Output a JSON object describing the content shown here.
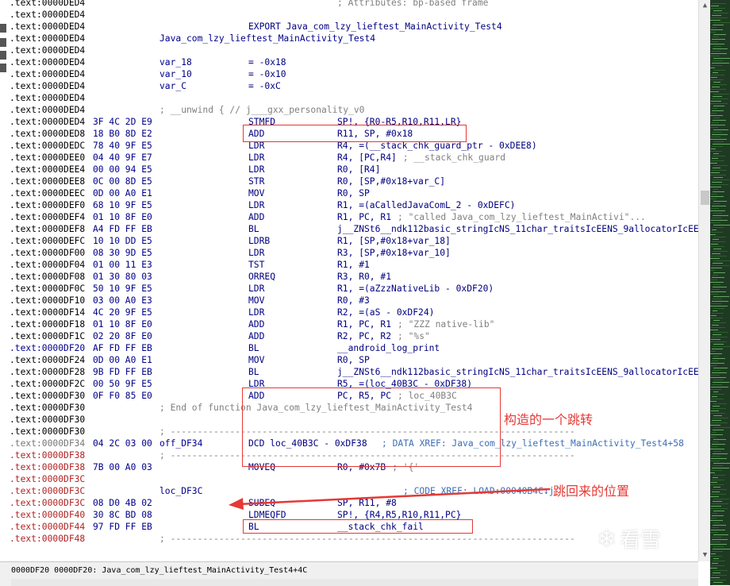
{
  "listing": [
    {
      "addr": ".text:0000DED4",
      "seg": "black",
      "bytes": "",
      "label": "",
      "mnem": "",
      "ops": "",
      "comment": "; Attributes: bp-based frame",
      "cc": "gray"
    },
    {
      "addr": ".text:0000DED4",
      "seg": "black",
      "bytes": "",
      "label": "",
      "mnem": "",
      "ops": "",
      "comment": "",
      "cc": "gray"
    },
    {
      "addr": ".text:0000DED4",
      "seg": "black",
      "bytes": "",
      "label": "",
      "mnem": "EXPORT Java_com_lzy_lieftest_MainActivity_Test4",
      "ops": "",
      "comment": "",
      "cc": "gray"
    },
    {
      "addr": ".text:0000DED4",
      "seg": "black",
      "bytes": "",
      "label": "Java_com_lzy_lieftest_MainActivity_Test4",
      "mnem": "",
      "ops": "",
      "comment": "",
      "cc": "gray"
    },
    {
      "addr": ".text:0000DED4",
      "seg": "black",
      "bytes": "",
      "label": "",
      "mnem": "",
      "ops": "",
      "comment": "",
      "cc": "gray"
    },
    {
      "addr": ".text:0000DED4",
      "seg": "black",
      "bytes": "",
      "label": "var_18",
      "mnem": "= -0x18",
      "ops": "",
      "comment": "",
      "cc": "gray"
    },
    {
      "addr": ".text:0000DED4",
      "seg": "black",
      "bytes": "",
      "label": "var_10",
      "mnem": "= -0x10",
      "ops": "",
      "comment": "",
      "cc": "gray"
    },
    {
      "addr": ".text:0000DED4",
      "seg": "black",
      "bytes": "",
      "label": "var_C",
      "mnem": "= -0xC",
      "ops": "",
      "comment": "",
      "cc": "gray"
    },
    {
      "addr": ".text:0000DED4",
      "seg": "black",
      "bytes": "",
      "label": "",
      "mnem": "",
      "ops": "",
      "comment": "",
      "cc": "gray"
    },
    {
      "addr": ".text:0000DED4",
      "seg": "black",
      "bytes": "",
      "label": "; __unwind { // j___gxx_personality_v0",
      "mnem": "",
      "ops": "",
      "comment": "",
      "cc": "gray"
    },
    {
      "addr": ".text:0000DED4",
      "seg": "black",
      "bytes": "3F 4C 2D E9",
      "label": "",
      "mnem": "STMFD",
      "ops": "SP!, {R0-R5,R10,R11,LR}",
      "comment": "",
      "cc": "gray"
    },
    {
      "addr": ".text:0000DED8",
      "seg": "black",
      "bytes": "18 B0 8D E2",
      "label": "",
      "mnem": "ADD",
      "ops": "R11, SP, #0x18",
      "comment": "",
      "cc": "gray"
    },
    {
      "addr": ".text:0000DEDC",
      "seg": "black",
      "bytes": "78 40 9F E5",
      "label": "",
      "mnem": "LDR",
      "ops": "R4, =(__stack_chk_guard_ptr - 0xDEE8)",
      "comment": "",
      "cc": "gray"
    },
    {
      "addr": ".text:0000DEE0",
      "seg": "black",
      "bytes": "04 40 9F E7",
      "label": "",
      "mnem": "LDR",
      "ops": "R4, [PC,R4]",
      "comment": "; __stack_chk_guard",
      "cc": "gray"
    },
    {
      "addr": ".text:0000DEE4",
      "seg": "black",
      "bytes": "00 00 94 E5",
      "label": "",
      "mnem": "LDR",
      "ops": "R0, [R4]",
      "comment": "",
      "cc": "gray"
    },
    {
      "addr": ".text:0000DEE8",
      "seg": "black",
      "bytes": "0C 00 8D E5",
      "label": "",
      "mnem": "STR",
      "ops": "R0, [SP,#0x18+var_C]",
      "comment": "",
      "cc": "gray"
    },
    {
      "addr": ".text:0000DEEC",
      "seg": "black",
      "bytes": "0D 00 A0 E1",
      "label": "",
      "mnem": "MOV",
      "ops": "R0, SP",
      "comment": "",
      "cc": "gray"
    },
    {
      "addr": ".text:0000DEF0",
      "seg": "black",
      "bytes": "68 10 9F E5",
      "label": "",
      "mnem": "LDR",
      "ops": "R1, =(aCalledJavaComL_2 - 0xDEFC)",
      "comment": "",
      "cc": "gray"
    },
    {
      "addr": ".text:0000DEF4",
      "seg": "black",
      "bytes": "01 10 8F E0",
      "label": "",
      "mnem": "ADD",
      "ops": "R1, PC, R1",
      "comment": "; \"called Java_com_lzy_lieftest_MainActivi\"...",
      "cc": "gray"
    },
    {
      "addr": ".text:0000DEF8",
      "seg": "black",
      "bytes": "A4 FD FF EB",
      "label": "",
      "mnem": "BL",
      "ops": "j__ZNSt6__ndk112basic_stringIcNS_11char_traitsIcEENS_9allocatorIcEEEC2IDnEEPKc",
      "comment": "",
      "cc": "gray"
    },
    {
      "addr": ".text:0000DEFC",
      "seg": "black",
      "bytes": "10 10 DD E5",
      "label": "",
      "mnem": "LDRB",
      "ops": "R1, [SP,#0x18+var_18]",
      "comment": "",
      "cc": "gray"
    },
    {
      "addr": ".text:0000DF00",
      "seg": "black",
      "bytes": "08 30 9D E5",
      "label": "",
      "mnem": "LDR",
      "ops": "R3, [SP,#0x18+var_10]",
      "comment": "",
      "cc": "gray"
    },
    {
      "addr": ".text:0000DF04",
      "seg": "black",
      "bytes": "01 00 11 E3",
      "label": "",
      "mnem": "TST",
      "ops": "R1, #1",
      "comment": "",
      "cc": "gray"
    },
    {
      "addr": ".text:0000DF08",
      "seg": "black",
      "bytes": "01 30 80 03",
      "label": "",
      "mnem": "ORREQ",
      "ops": "R3, R0, #1",
      "comment": "",
      "cc": "gray"
    },
    {
      "addr": ".text:0000DF0C",
      "seg": "black",
      "bytes": "50 10 9F E5",
      "label": "",
      "mnem": "LDR",
      "ops": "R1, =(aZzzNativeLib - 0xDF20)",
      "comment": "",
      "cc": "gray"
    },
    {
      "addr": ".text:0000DF10",
      "seg": "black",
      "bytes": "03 00 A0 E3",
      "label": "",
      "mnem": "MOV",
      "ops": "R0, #3",
      "comment": "",
      "cc": "gray"
    },
    {
      "addr": ".text:0000DF14",
      "seg": "black",
      "bytes": "4C 20 9F E5",
      "label": "",
      "mnem": "LDR",
      "ops": "R2, =(aS - 0xDF24)",
      "comment": "",
      "cc": "gray"
    },
    {
      "addr": ".text:0000DF18",
      "seg": "black",
      "bytes": "01 10 8F E0",
      "label": "",
      "mnem": "ADD",
      "ops": "R1, PC, R1",
      "comment": "; \"ZZZ native-lib\"",
      "cc": "gray"
    },
    {
      "addr": ".text:0000DF1C",
      "seg": "black",
      "bytes": "02 20 8F E0",
      "label": "",
      "mnem": "ADD",
      "ops": "R2, PC, R2",
      "comment": "; \"%s\"",
      "cc": "gray"
    },
    {
      "addr": ".text:0000DF20",
      "seg": "blue",
      "bytes": "AF FD FF EB",
      "label": "",
      "mnem": "BL",
      "ops": "__android_log_print",
      "comment": "",
      "cc": "gray"
    },
    {
      "addr": ".text:0000DF24",
      "seg": "black",
      "bytes": "0D 00 A0 E1",
      "label": "",
      "mnem": "MOV",
      "ops": "R0, SP",
      "comment": "",
      "cc": "gray"
    },
    {
      "addr": ".text:0000DF28",
      "seg": "black",
      "bytes": "9B FD FF EB",
      "label": "",
      "mnem": "BL",
      "ops": "j__ZNSt6__ndk112basic_stringIcNS_11char_traitsIcEENS_9allocatorIcEEED2Ev",
      "comment": "",
      "cc": "gray"
    },
    {
      "addr": ".text:0000DF2C",
      "seg": "black",
      "bytes": "00 50 9F E5",
      "label": "",
      "mnem": "LDR",
      "ops": "R5, =(loc_40B3C - 0xDF38)",
      "comment": "",
      "cc": "gray"
    },
    {
      "addr": ".text:0000DF30",
      "seg": "black",
      "bytes": "0F F0 85 E0",
      "label": "",
      "mnem": "ADD",
      "ops": "PC, R5, PC",
      "comment": "; loc_40B3C",
      "cc": "gray"
    },
    {
      "addr": ".text:0000DF30",
      "seg": "black",
      "bytes": "",
      "label": "; End of function Java_com_lzy_lieftest_MainActivity_Test4",
      "mnem": "",
      "ops": "",
      "comment": "",
      "cc": "gray"
    },
    {
      "addr": ".text:0000DF30",
      "seg": "black",
      "bytes": "",
      "label": "",
      "mnem": "",
      "ops": "",
      "comment": "",
      "cc": "gray"
    },
    {
      "addr": ".text:0000DF30",
      "seg": "black",
      "bytes": "",
      "label": "; ---------------------------------------------------------------------------",
      "mnem": "",
      "ops": "",
      "comment": "",
      "cc": "gray"
    },
    {
      "addr": ".text:0000DF34",
      "seg": "gray",
      "bytes": "04 2C 03 00",
      "label": "off_DF34",
      "mnem": "DCD loc_40B3C - 0xDF38",
      "ops": "",
      "comment": "; DATA XREF: Java_com_lzy_lieftest_MainActivity_Test4+58",
      "cc": "blue"
    },
    {
      "addr": ".text:0000DF38",
      "seg": "red",
      "bytes": "",
      "label": "; ---------------------------------------------------------------------------",
      "mnem": "",
      "ops": "",
      "comment": "",
      "cc": "gray"
    },
    {
      "addr": ".text:0000DF38",
      "seg": "red",
      "bytes": "7B 00 A0 03",
      "label": "",
      "mnem": "MOVEQ",
      "ops": "R0, #0x7B",
      "comment": "; '{'",
      "cc": "gray"
    },
    {
      "addr": ".text:0000DF3C",
      "seg": "red",
      "bytes": "",
      "label": "",
      "mnem": "",
      "ops": "",
      "comment": "",
      "cc": "gray"
    },
    {
      "addr": ".text:0000DF3C",
      "seg": "red",
      "bytes": "",
      "label": "loc_DF3C",
      "mnem": "",
      "ops": "",
      "comment": "; CODE XREF: LOAD:00040B4C↓j",
      "cc": "blue"
    },
    {
      "addr": ".text:0000DF3C",
      "seg": "red",
      "bytes": "08 D0 4B 02",
      "label": "",
      "mnem": "SUBEQ",
      "ops": "SP, R11, #8",
      "comment": "",
      "cc": "gray"
    },
    {
      "addr": ".text:0000DF40",
      "seg": "red",
      "bytes": "30 8C BD 08",
      "label": "",
      "mnem": "LDMEQFD",
      "ops": "SP!, {R4,R5,R10,R11,PC}",
      "comment": "",
      "cc": "gray"
    },
    {
      "addr": ".text:0000DF44",
      "seg": "red",
      "bytes": "97 FD FF EB",
      "label": "",
      "mnem": "BL",
      "ops": "__stack_chk_fail",
      "comment": "",
      "cc": "gray"
    },
    {
      "addr": ".text:0000DF48",
      "seg": "red",
      "bytes": "",
      "label": "; ---------------------------------------------------------------------------",
      "mnem": "",
      "ops": "",
      "comment": "",
      "cc": "gray"
    }
  ],
  "annotations": {
    "constructed_jump": "构造的一个跳转",
    "return_position": "跳回来的位置"
  },
  "status_bar": {
    "text": "0000DF20 0000DF20: Java_com_lzy_lieftest_MainActivity_Test4+4C"
  },
  "watermark": {
    "text": "看雪"
  },
  "colors": {
    "highlight": "#e53935",
    "segment_red": "#b22222",
    "segment_blue": "#00008b",
    "minimap_bg": "#1f3a23"
  }
}
